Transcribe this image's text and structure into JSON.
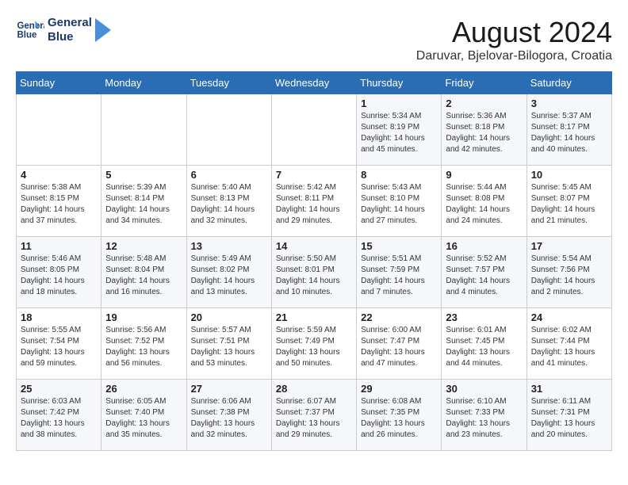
{
  "header": {
    "logo_line1": "General",
    "logo_line2": "Blue",
    "month_year": "August 2024",
    "location": "Daruvar, Bjelovar-Bilogora, Croatia"
  },
  "days_of_week": [
    "Sunday",
    "Monday",
    "Tuesday",
    "Wednesday",
    "Thursday",
    "Friday",
    "Saturday"
  ],
  "weeks": [
    [
      {
        "day": "",
        "info": ""
      },
      {
        "day": "",
        "info": ""
      },
      {
        "day": "",
        "info": ""
      },
      {
        "day": "",
        "info": ""
      },
      {
        "day": "1",
        "info": "Sunrise: 5:34 AM\nSunset: 8:19 PM\nDaylight: 14 hours\nand 45 minutes."
      },
      {
        "day": "2",
        "info": "Sunrise: 5:36 AM\nSunset: 8:18 PM\nDaylight: 14 hours\nand 42 minutes."
      },
      {
        "day": "3",
        "info": "Sunrise: 5:37 AM\nSunset: 8:17 PM\nDaylight: 14 hours\nand 40 minutes."
      }
    ],
    [
      {
        "day": "4",
        "info": "Sunrise: 5:38 AM\nSunset: 8:15 PM\nDaylight: 14 hours\nand 37 minutes."
      },
      {
        "day": "5",
        "info": "Sunrise: 5:39 AM\nSunset: 8:14 PM\nDaylight: 14 hours\nand 34 minutes."
      },
      {
        "day": "6",
        "info": "Sunrise: 5:40 AM\nSunset: 8:13 PM\nDaylight: 14 hours\nand 32 minutes."
      },
      {
        "day": "7",
        "info": "Sunrise: 5:42 AM\nSunset: 8:11 PM\nDaylight: 14 hours\nand 29 minutes."
      },
      {
        "day": "8",
        "info": "Sunrise: 5:43 AM\nSunset: 8:10 PM\nDaylight: 14 hours\nand 27 minutes."
      },
      {
        "day": "9",
        "info": "Sunrise: 5:44 AM\nSunset: 8:08 PM\nDaylight: 14 hours\nand 24 minutes."
      },
      {
        "day": "10",
        "info": "Sunrise: 5:45 AM\nSunset: 8:07 PM\nDaylight: 14 hours\nand 21 minutes."
      }
    ],
    [
      {
        "day": "11",
        "info": "Sunrise: 5:46 AM\nSunset: 8:05 PM\nDaylight: 14 hours\nand 18 minutes."
      },
      {
        "day": "12",
        "info": "Sunrise: 5:48 AM\nSunset: 8:04 PM\nDaylight: 14 hours\nand 16 minutes."
      },
      {
        "day": "13",
        "info": "Sunrise: 5:49 AM\nSunset: 8:02 PM\nDaylight: 14 hours\nand 13 minutes."
      },
      {
        "day": "14",
        "info": "Sunrise: 5:50 AM\nSunset: 8:01 PM\nDaylight: 14 hours\nand 10 minutes."
      },
      {
        "day": "15",
        "info": "Sunrise: 5:51 AM\nSunset: 7:59 PM\nDaylight: 14 hours\nand 7 minutes."
      },
      {
        "day": "16",
        "info": "Sunrise: 5:52 AM\nSunset: 7:57 PM\nDaylight: 14 hours\nand 4 minutes."
      },
      {
        "day": "17",
        "info": "Sunrise: 5:54 AM\nSunset: 7:56 PM\nDaylight: 14 hours\nand 2 minutes."
      }
    ],
    [
      {
        "day": "18",
        "info": "Sunrise: 5:55 AM\nSunset: 7:54 PM\nDaylight: 13 hours\nand 59 minutes."
      },
      {
        "day": "19",
        "info": "Sunrise: 5:56 AM\nSunset: 7:52 PM\nDaylight: 13 hours\nand 56 minutes."
      },
      {
        "day": "20",
        "info": "Sunrise: 5:57 AM\nSunset: 7:51 PM\nDaylight: 13 hours\nand 53 minutes."
      },
      {
        "day": "21",
        "info": "Sunrise: 5:59 AM\nSunset: 7:49 PM\nDaylight: 13 hours\nand 50 minutes."
      },
      {
        "day": "22",
        "info": "Sunrise: 6:00 AM\nSunset: 7:47 PM\nDaylight: 13 hours\nand 47 minutes."
      },
      {
        "day": "23",
        "info": "Sunrise: 6:01 AM\nSunset: 7:45 PM\nDaylight: 13 hours\nand 44 minutes."
      },
      {
        "day": "24",
        "info": "Sunrise: 6:02 AM\nSunset: 7:44 PM\nDaylight: 13 hours\nand 41 minutes."
      }
    ],
    [
      {
        "day": "25",
        "info": "Sunrise: 6:03 AM\nSunset: 7:42 PM\nDaylight: 13 hours\nand 38 minutes."
      },
      {
        "day": "26",
        "info": "Sunrise: 6:05 AM\nSunset: 7:40 PM\nDaylight: 13 hours\nand 35 minutes."
      },
      {
        "day": "27",
        "info": "Sunrise: 6:06 AM\nSunset: 7:38 PM\nDaylight: 13 hours\nand 32 minutes."
      },
      {
        "day": "28",
        "info": "Sunrise: 6:07 AM\nSunset: 7:37 PM\nDaylight: 13 hours\nand 29 minutes."
      },
      {
        "day": "29",
        "info": "Sunrise: 6:08 AM\nSunset: 7:35 PM\nDaylight: 13 hours\nand 26 minutes."
      },
      {
        "day": "30",
        "info": "Sunrise: 6:10 AM\nSunset: 7:33 PM\nDaylight: 13 hours\nand 23 minutes."
      },
      {
        "day": "31",
        "info": "Sunrise: 6:11 AM\nSunset: 7:31 PM\nDaylight: 13 hours\nand 20 minutes."
      }
    ]
  ]
}
